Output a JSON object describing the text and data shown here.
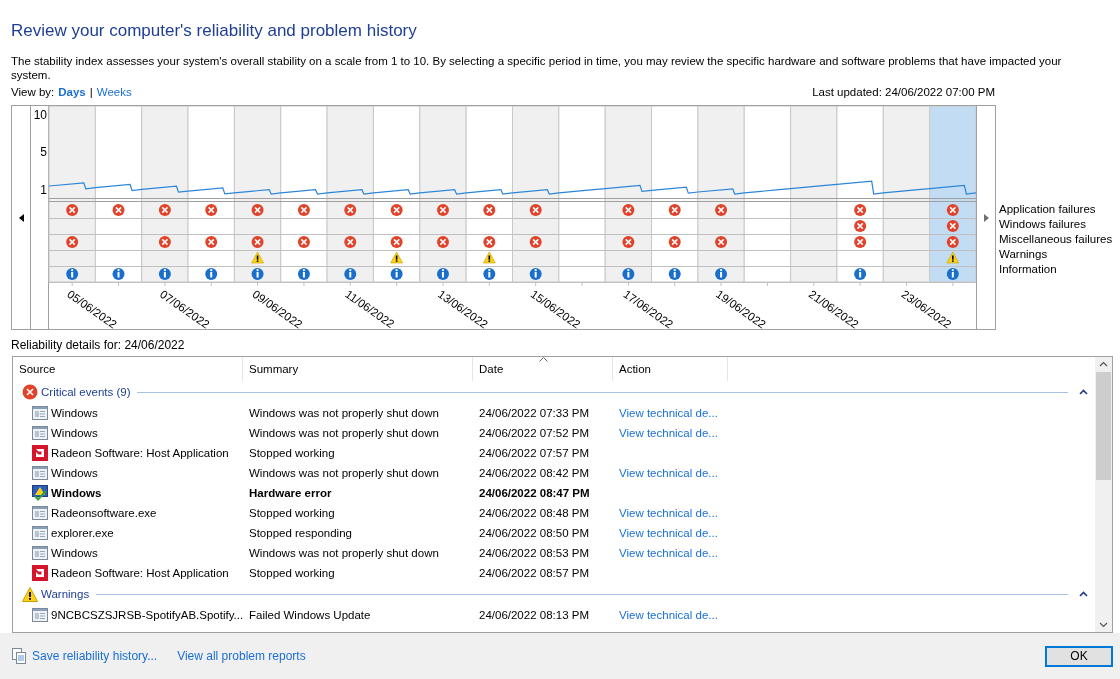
{
  "title": "Review your computer's reliability and problem history",
  "description": "The stability index assesses your system's overall stability on a scale from 1 to 10. By selecting a specific period in time, you may review the specific hardware and software problems that have impacted your system.",
  "view_by": {
    "label": "View by:",
    "options": [
      {
        "label": "Days",
        "selected": true
      },
      {
        "label": "Weeks",
        "selected": false
      }
    ],
    "separator": "|"
  },
  "last_updated": "Last updated: 24/06/2022 07:00 PM",
  "chart": {
    "y_axis_labels": [
      "10",
      "5",
      "1"
    ],
    "legend": [
      "Application failures",
      "Windows failures",
      "Miscellaneous failures",
      "Warnings",
      "Information"
    ],
    "date_labels": [
      "05/06/2022",
      "07/06/2022",
      "09/06/2022",
      "11/06/2022",
      "13/06/2022",
      "15/06/2022",
      "17/06/2022",
      "19/06/2022",
      "21/06/2022",
      "23/06/2022"
    ],
    "days": [
      {
        "selected": false,
        "app": true,
        "windows": false,
        "misc": true,
        "warning": false,
        "info": true
      },
      {
        "selected": false,
        "app": true,
        "windows": false,
        "misc": false,
        "warning": false,
        "info": true
      },
      {
        "selected": false,
        "app": true,
        "windows": false,
        "misc": true,
        "warning": false,
        "info": true
      },
      {
        "selected": false,
        "app": true,
        "windows": false,
        "misc": true,
        "warning": false,
        "info": true
      },
      {
        "selected": false,
        "app": true,
        "windows": false,
        "misc": true,
        "warning": true,
        "info": true
      },
      {
        "selected": false,
        "app": true,
        "windows": false,
        "misc": true,
        "warning": false,
        "info": true
      },
      {
        "selected": false,
        "app": true,
        "windows": false,
        "misc": true,
        "warning": false,
        "info": true
      },
      {
        "selected": false,
        "app": true,
        "windows": false,
        "misc": true,
        "warning": true,
        "info": true
      },
      {
        "selected": false,
        "app": true,
        "windows": false,
        "misc": true,
        "warning": false,
        "info": true
      },
      {
        "selected": false,
        "app": true,
        "windows": false,
        "misc": true,
        "warning": true,
        "info": true
      },
      {
        "selected": false,
        "app": true,
        "windows": false,
        "misc": true,
        "warning": false,
        "info": true
      },
      {
        "selected": false,
        "app": false,
        "windows": false,
        "misc": false,
        "warning": false,
        "info": false
      },
      {
        "selected": false,
        "app": true,
        "windows": false,
        "misc": true,
        "warning": false,
        "info": true
      },
      {
        "selected": false,
        "app": true,
        "windows": false,
        "misc": true,
        "warning": false,
        "info": true
      },
      {
        "selected": false,
        "app": true,
        "windows": false,
        "misc": true,
        "warning": false,
        "info": true
      },
      {
        "selected": false,
        "app": false,
        "windows": false,
        "misc": false,
        "warning": false,
        "info": false
      },
      {
        "selected": false,
        "app": false,
        "windows": false,
        "misc": false,
        "warning": false,
        "info": false
      },
      {
        "selected": false,
        "app": true,
        "windows": true,
        "misc": true,
        "warning": false,
        "info": true
      },
      {
        "selected": false,
        "app": false,
        "windows": false,
        "misc": false,
        "warning": false,
        "info": false
      },
      {
        "selected": true,
        "app": true,
        "windows": true,
        "misc": true,
        "warning": true,
        "info": true
      }
    ]
  },
  "details_label": "Reliability details for: 24/06/2022",
  "table": {
    "columns": [
      "Source",
      "Summary",
      "Date",
      "Action"
    ],
    "groups": [
      {
        "kind": "error",
        "label": "Critical events (9)",
        "expanded": true,
        "rows": [
          {
            "kind": "window",
            "source": "Windows",
            "summary": "Windows was not properly shut down",
            "date": "24/06/2022 07:33 PM",
            "action": "View technical de...",
            "emphasized": false
          },
          {
            "kind": "window",
            "source": "Windows",
            "summary": "Windows was not properly shut down",
            "date": "24/06/2022 07:52 PM",
            "action": "View technical de...",
            "emphasized": false
          },
          {
            "kind": "app",
            "source": "Radeon Software: Host Application",
            "summary": "Stopped working",
            "date": "24/06/2022 07:57 PM",
            "emphasized": false
          },
          {
            "kind": "window",
            "source": "Windows",
            "summary": "Windows was not properly shut down",
            "date": "24/06/2022 08:42 PM",
            "action": "View technical de...",
            "emphasized": false
          },
          {
            "kind": "hardware",
            "source": "Windows",
            "summary": "Hardware error",
            "date": "24/06/2022 08:47 PM",
            "emphasized": true
          },
          {
            "kind": "window",
            "source": "Radeonsoftware.exe",
            "summary": "Stopped working",
            "date": "24/06/2022 08:48 PM",
            "action": "View technical de...",
            "emphasized": false
          },
          {
            "kind": "window",
            "source": "explorer.exe",
            "summary": "Stopped responding",
            "date": "24/06/2022 08:50 PM",
            "action": "View technical de...",
            "emphasized": false
          },
          {
            "kind": "window",
            "source": "Windows",
            "summary": "Windows was not properly shut down",
            "date": "24/06/2022 08:53 PM",
            "action": "View technical de...",
            "emphasized": false
          },
          {
            "kind": "app",
            "source": "Radeon Software: Host Application",
            "summary": "Stopped working",
            "date": "24/06/2022 08:57 PM",
            "emphasized": false
          }
        ]
      },
      {
        "kind": "warning",
        "label": "Warnings",
        "expanded": true,
        "rows": [
          {
            "kind": "window",
            "source": "9NCBCSZSJRSB-SpotifyAB.Spotify...",
            "summary": "Failed Windows Update",
            "date": "24/06/2022 08:13 PM",
            "action": "View technical de...",
            "emphasized": false
          }
        ]
      }
    ]
  },
  "footer": {
    "links": [
      "Save reliability history...",
      "View all problem reports"
    ],
    "button": "OK"
  }
}
